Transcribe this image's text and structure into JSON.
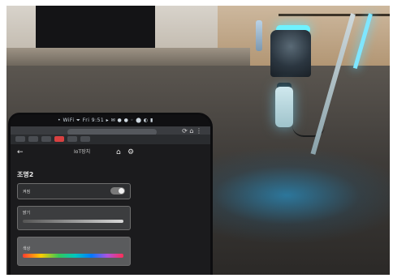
{
  "photo": {
    "description_icons": [
      "lamp-icon"
    ],
    "accent_colors": {
      "lamp_glow": "#6ff2ff",
      "floor_glow": "#2f8fbf"
    }
  },
  "tablet": {
    "statusbar_text": "•  WiFi  ⏷  Fri 9:51  ▸  ✉  ●  ●  ◦  ⬤  ◐  ▮",
    "app": {
      "header": {
        "title": "IoT장치",
        "back_icon": "←",
        "home_icon": "⌂",
        "gear_icon": "⚙"
      },
      "section_label": "조명2",
      "controls": {
        "power_label": "켜짐",
        "brightness_label": "밝기",
        "color_label": "색상"
      }
    }
  }
}
